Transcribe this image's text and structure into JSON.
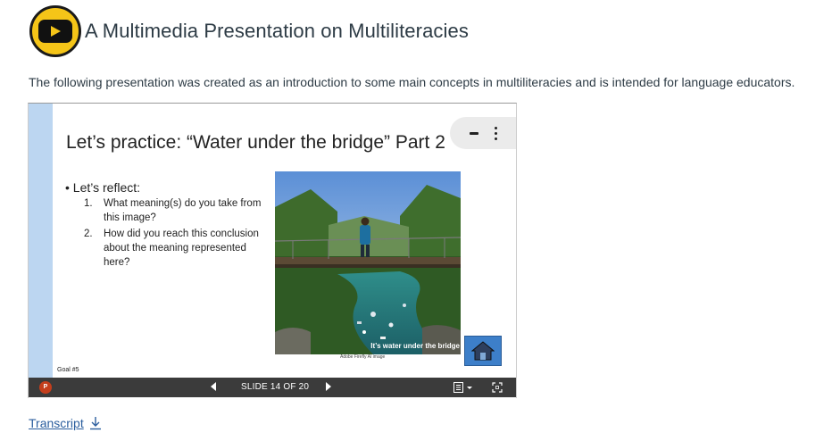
{
  "header": {
    "title": "A Multimedia Presentation on Multiliteracies",
    "icon": "youtube-play-icon",
    "icon_bg": "#f5c518"
  },
  "intro": "The following presentation was created as an introduction to some main concepts in multiliteracies and is intended for language educators.",
  "slide": {
    "title": "Let’s practice: “Water under the bridge” Part 2",
    "bullet": "Let’s reflect:",
    "questions": [
      {
        "num": "1.",
        "text": "What meaning(s) do you take from this image?"
      },
      {
        "num": "2.",
        "text": "How did you reach this conclusion about the meaning represented here?"
      }
    ],
    "image_caption": "It’s water under the bridge",
    "image_credit": "Adobe Firefly AI image",
    "footer": "Goal #5",
    "home_icon": "home-icon"
  },
  "controls": {
    "logo": "P",
    "slide_indicator": "SLIDE 14 OF 20"
  },
  "transcript": {
    "label": "Transcript",
    "icon": "download-icon"
  },
  "colors": {
    "slide_sidebar": "#bcd6f1",
    "toolbar": "#3b3b3b",
    "link": "#2b5e9e",
    "home_button": "#3d7fc9"
  }
}
